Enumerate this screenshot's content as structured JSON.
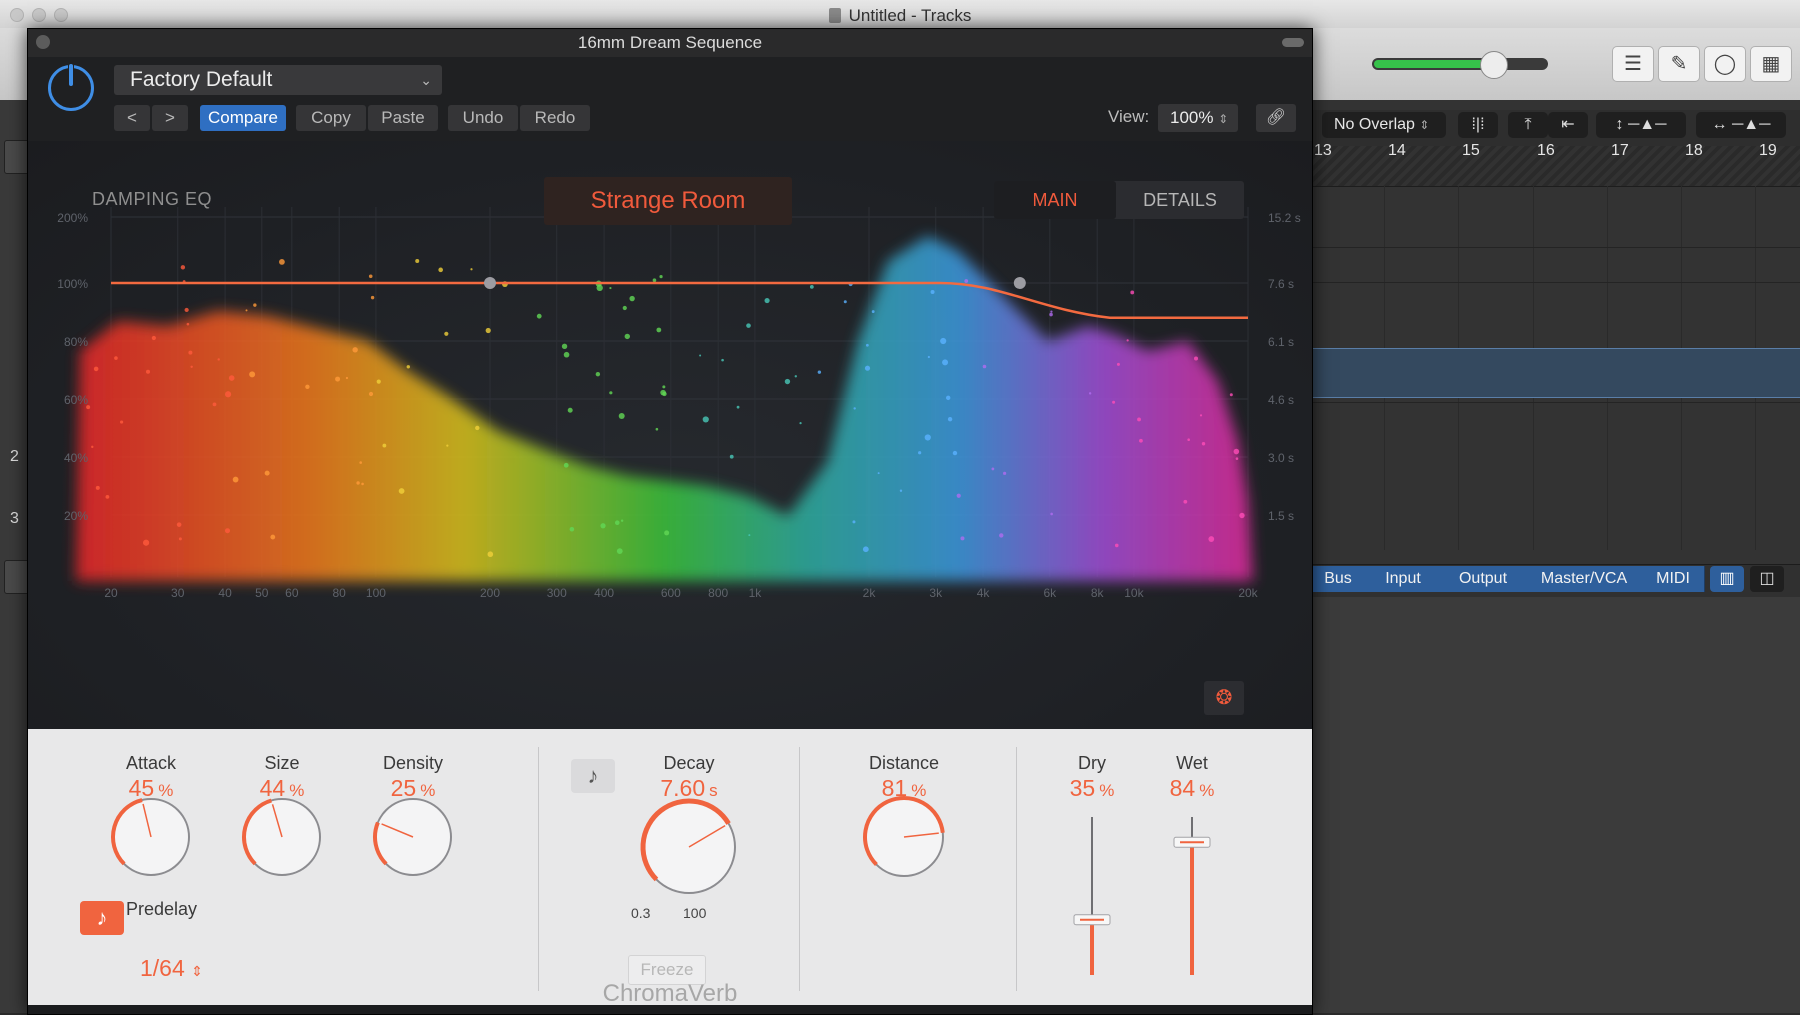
{
  "host": {
    "window_title": "Untitled - Tracks",
    "overlap_mode": "No Overlap",
    "ruler_numbers": [
      "13",
      "14",
      "15",
      "16",
      "17",
      "18",
      "19"
    ],
    "mixer_tabs": [
      "Bus",
      "Input",
      "Output",
      "Master/VCA",
      "MIDI"
    ],
    "track_numbers": [
      "2",
      "3"
    ]
  },
  "plugin": {
    "window_title": "16mm Dream Sequence",
    "preset": "Factory Default",
    "buttons": {
      "back": "<",
      "forward": ">",
      "compare": "Compare",
      "copy": "Copy",
      "paste": "Paste",
      "undo": "Undo",
      "redo": "Redo"
    },
    "view_label": "View:",
    "view_value": "100%",
    "damping_eq": "DAMPING EQ",
    "room_type": "Strange Room",
    "tabs": {
      "main": "MAIN",
      "details": "DETAILS"
    },
    "product_name": "ChromaVerb"
  },
  "eq_display": {
    "y_left_ticks": [
      "200%",
      "100%",
      "80%",
      "60%",
      "40%",
      "20%"
    ],
    "y_right_ticks": [
      "15.2 s",
      "7.6 s",
      "6.1 s",
      "4.6 s",
      "3.0 s",
      "1.5 s"
    ],
    "x_ticks": [
      "20",
      "30",
      "40",
      "50",
      "60",
      "80",
      "100",
      "200",
      "300",
      "400",
      "600",
      "800",
      "1k",
      "2k",
      "3k",
      "4k",
      "6k",
      "8k",
      "10k",
      "20k"
    ],
    "curve": {
      "low_node_hz": 200,
      "low_node_pct": 100,
      "high_node_hz": 5000,
      "high_node_pct": 100,
      "end_pct": 88
    }
  },
  "controls": {
    "attack": {
      "label": "Attack",
      "value": "45",
      "unit": "%",
      "fraction": 0.45
    },
    "size": {
      "label": "Size",
      "value": "44",
      "unit": "%",
      "fraction": 0.44
    },
    "density": {
      "label": "Density",
      "value": "25",
      "unit": "%",
      "fraction": 0.25
    },
    "decay": {
      "label": "Decay",
      "value": "7.60",
      "unit": "s",
      "fraction": 0.72,
      "range_min": "0.3",
      "range_max": "100"
    },
    "distance": {
      "label": "Distance",
      "value": "81",
      "unit": "%",
      "fraction": 0.81
    },
    "dry": {
      "label": "Dry",
      "value": "35",
      "unit": "%",
      "fraction": 0.35
    },
    "wet": {
      "label": "Wet",
      "value": "84",
      "unit": "%",
      "fraction": 0.84
    },
    "predelay": {
      "label": "Predelay",
      "value": "1/64"
    },
    "freeze": "Freeze"
  },
  "colors": {
    "accent": "#f0643f",
    "selection_blue": "#2f6fc2"
  }
}
